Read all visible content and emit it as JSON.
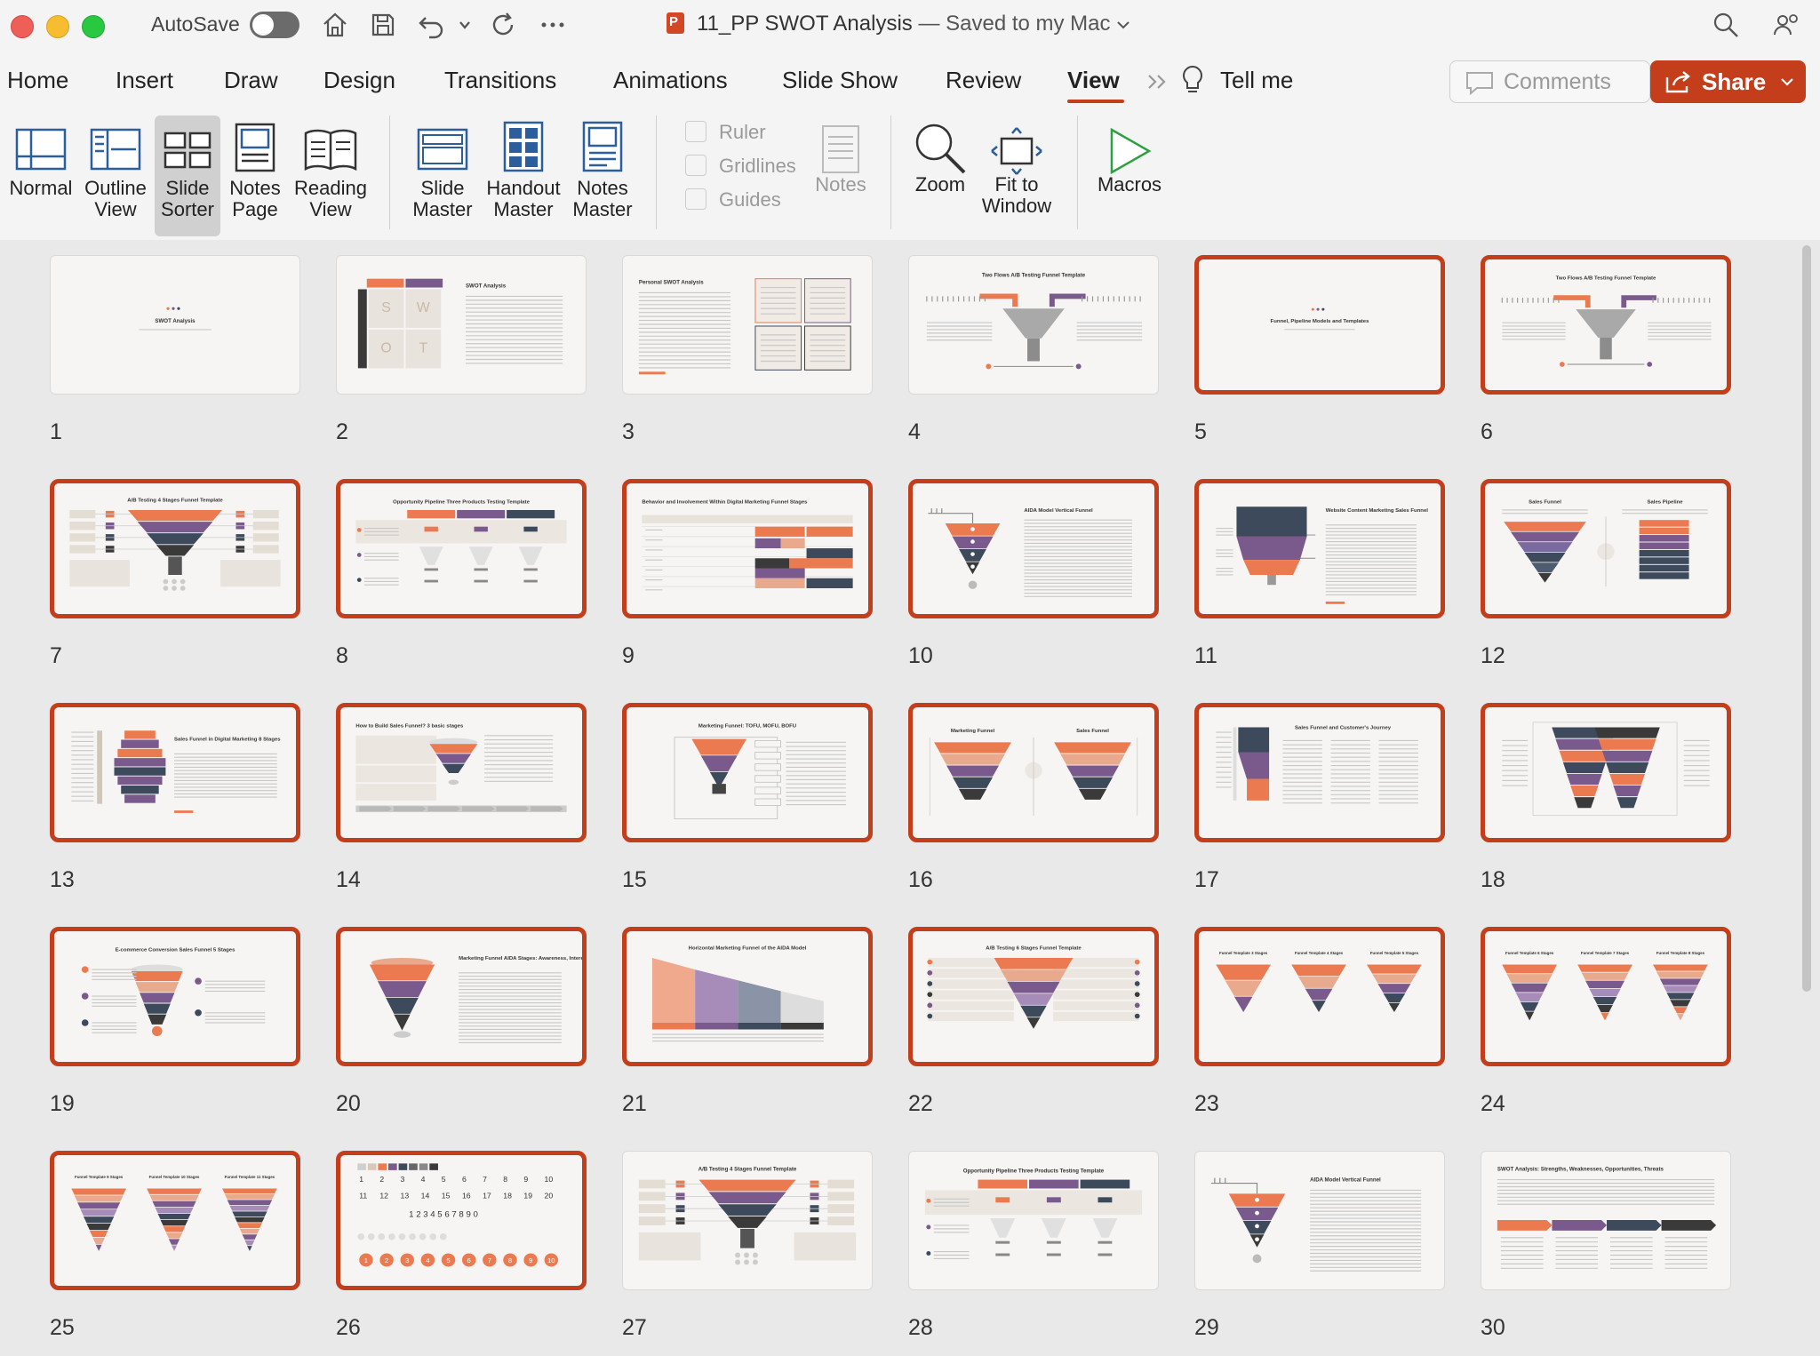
{
  "window": {
    "autosave_label": "AutoSave",
    "doc_name": "11_PP SWOT Analysis",
    "save_status": "— Saved to my Mac"
  },
  "tabs": [
    "Home",
    "Insert",
    "Draw",
    "Design",
    "Transitions",
    "Animations",
    "Slide Show",
    "Review",
    "View",
    "Tell me"
  ],
  "active_tab": "View",
  "actions": {
    "comments": "Comments",
    "share": "Share"
  },
  "ribbon": {
    "normal": [
      "Normal",
      ""
    ],
    "outline": [
      "Outline",
      "View"
    ],
    "slide_sorter": [
      "Slide",
      "Sorter"
    ],
    "notes_page": [
      "Notes",
      "Page"
    ],
    "reading": [
      "Reading",
      "View"
    ],
    "slide_master": [
      "Slide",
      "Master"
    ],
    "handout_master": [
      "Handout",
      "Master"
    ],
    "notes_master": [
      "Notes",
      "Master"
    ],
    "ruler": "Ruler",
    "gridlines": "Gridlines",
    "guides": "Guides",
    "notes": "Notes",
    "zoom": "Zoom",
    "fit": [
      "Fit to",
      "Window"
    ],
    "macros": "Macros"
  },
  "colors": {
    "accent": "#c43e1c",
    "orange": "#ec7a50",
    "purple": "#7a5a8c",
    "navy": "#3d4a5c"
  },
  "slides": [
    {
      "n": "1",
      "title": "SWOT Analysis",
      "kind": "title",
      "sel": false
    },
    {
      "n": "2",
      "title": "SWOT Analysis",
      "kind": "swot",
      "sel": false
    },
    {
      "n": "3",
      "title": "Personal SWOT Analysis",
      "kind": "personal",
      "sel": false
    },
    {
      "n": "4",
      "title": "Two Flows A/B Testing Funnel Template",
      "kind": "twoflow",
      "sel": false
    },
    {
      "n": "5",
      "title": "Funnel, Pipeline Models and Templates",
      "kind": "title",
      "sel": true
    },
    {
      "n": "6",
      "title": "Two Flows A/B Testing Funnel Template",
      "kind": "twoflow",
      "sel": true
    },
    {
      "n": "7",
      "title": "A/B Testing 4 Stages Funnel Template",
      "kind": "ab4",
      "sel": true
    },
    {
      "n": "8",
      "title": "Opportunity Pipeline Three Products Testing Template",
      "kind": "pipeline",
      "sel": true
    },
    {
      "n": "9",
      "title": "Behavior and Involvement Within Digital Marketing Funnel Stages",
      "kind": "table",
      "sel": true
    },
    {
      "n": "10",
      "title": "AIDA Model Vertical Funnel",
      "kind": "aida",
      "sel": true
    },
    {
      "n": "11",
      "title": "Website Content Marketing Sales Funnel",
      "kind": "website",
      "sel": true
    },
    {
      "n": "12",
      "title": "Sales Funnel",
      "kind": "vs",
      "sel": true
    },
    {
      "n": "13",
      "title": "Sales Funnel in Digital Marketing 8 Stages",
      "kind": "digital8",
      "sel": true
    },
    {
      "n": "14",
      "title": "How to Build Sales Funnel? 3 basic stages",
      "kind": "build",
      "sel": true
    },
    {
      "n": "15",
      "title": "Marketing Funnel: TOFU, MOFU, BOFU",
      "kind": "tofu",
      "sel": true
    },
    {
      "n": "16",
      "title": "Marketing Funnel",
      "kind": "vs2",
      "sel": true
    },
    {
      "n": "17",
      "title": "Sales Funnel and Customer's Journey",
      "kind": "journey",
      "sel": true
    },
    {
      "n": "18",
      "title": "",
      "kind": "butterfly",
      "sel": true
    },
    {
      "n": "19",
      "title": "E-commerce Conversion Sales Funnel 5 Stages",
      "kind": "ecom",
      "sel": true
    },
    {
      "n": "20",
      "title": "Marketing Funnel AIDA Stages: Awareness, Interest, Desire and Action",
      "kind": "aida2",
      "sel": true
    },
    {
      "n": "21",
      "title": "Horizontal Marketing Funnel of the AIDA Model",
      "kind": "horiz",
      "sel": true
    },
    {
      "n": "22",
      "title": "A/B Testing 6 Stages Funnel Template",
      "kind": "ab6",
      "sel": true
    },
    {
      "n": "23",
      "title": "Funnel Template 3 Stages",
      "kind": "tri3",
      "sel": true
    },
    {
      "n": "24",
      "title": "Funnel Template 6 Stages",
      "kind": "tri6",
      "sel": true
    },
    {
      "n": "25",
      "title": "Funnel Template 9 Stages",
      "kind": "tri9",
      "sel": true
    },
    {
      "n": "26",
      "title": "",
      "kind": "numbers",
      "sel": true
    },
    {
      "n": "27",
      "title": "A/B Testing 4 Stages Funnel Template",
      "kind": "ab4",
      "sel": false
    },
    {
      "n": "28",
      "title": "Opportunity Pipeline Three Products Testing Template",
      "kind": "pipeline",
      "sel": false
    },
    {
      "n": "29",
      "title": "AIDA Model Vertical Funnel",
      "kind": "aida",
      "sel": false
    },
    {
      "n": "30",
      "title": "SWOT Analysis: Strengths, Weaknesses, Opportunities, Threats",
      "kind": "swot30",
      "sel": false
    }
  ]
}
